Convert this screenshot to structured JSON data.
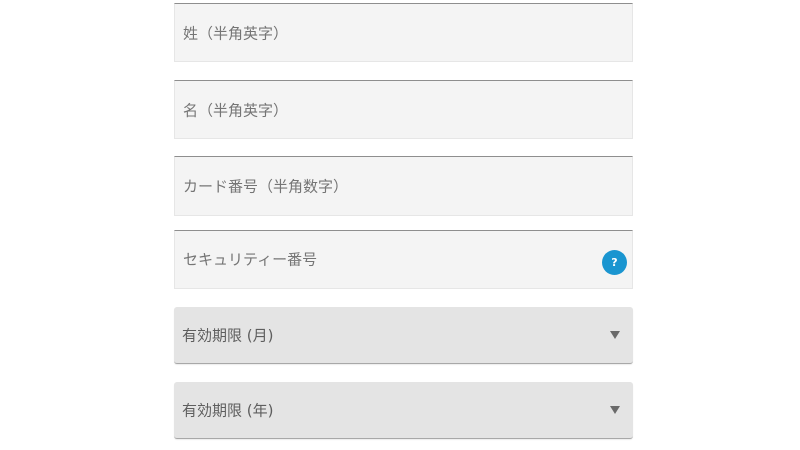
{
  "form": {
    "last_name": {
      "placeholder": "姓（半角英字）"
    },
    "first_name": {
      "placeholder": "名（半角英字）"
    },
    "card_number": {
      "placeholder": "カード番号（半角数字）"
    },
    "security_code": {
      "placeholder": "セキュリティー番号",
      "help_label": "?"
    },
    "expiry_month": {
      "selected": "有効期限 (月)"
    },
    "expiry_year": {
      "selected": "有効期限 (年)"
    }
  },
  "colors": {
    "help_icon": "#1a95d0",
    "field_background": "#f4f4f4",
    "select_background": "#e4e4e4"
  },
  "icons": {
    "help": "question-icon",
    "dropdown": "chevron-down-icon"
  }
}
